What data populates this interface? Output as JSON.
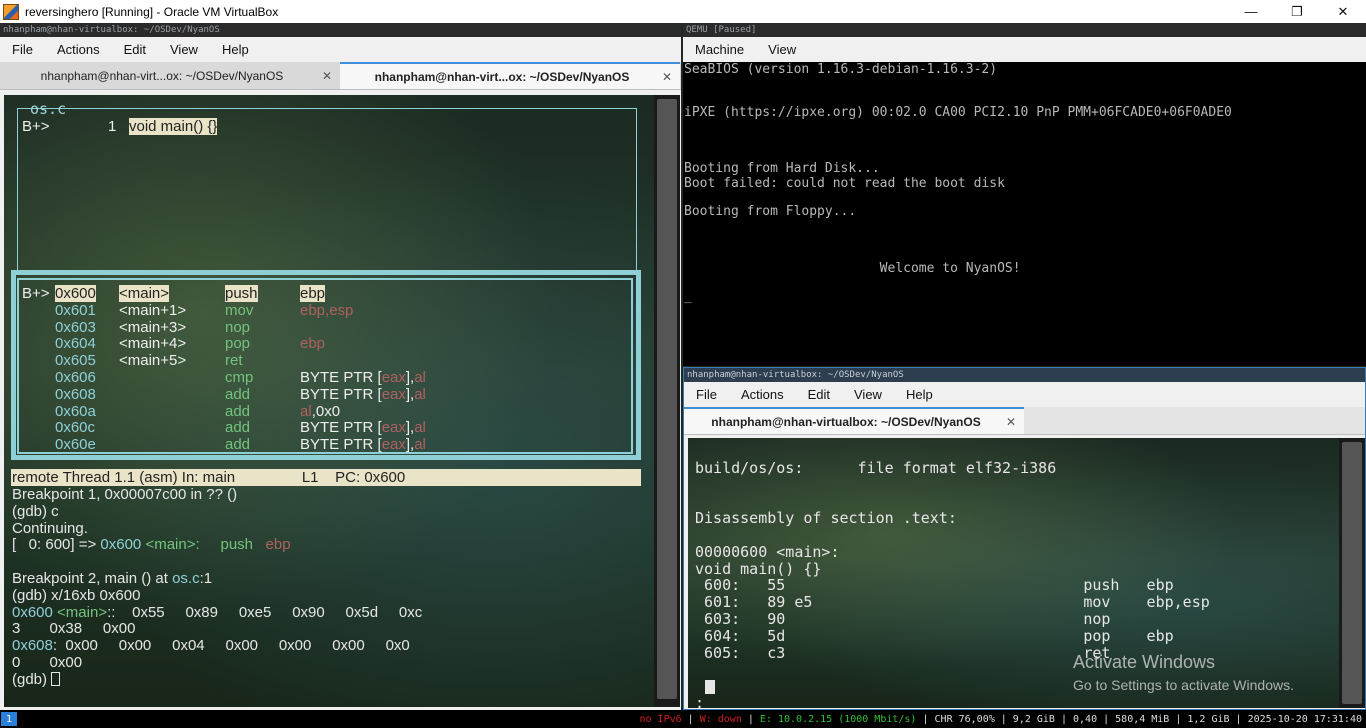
{
  "host": {
    "title": "reversinghero [Running] - Oracle VM VirtualBox",
    "minimize": "—",
    "maximize": "❐",
    "close": "✕"
  },
  "left_window": {
    "title": "nhanpham@nhan-virtualbox: ~/OSDev/NyanOS",
    "menu": [
      "File",
      "Actions",
      "Edit",
      "View",
      "Help"
    ],
    "tabs": [
      {
        "label": "nhanpham@nhan-virt...ox: ~/OSDev/NyanOS",
        "close": "✕"
      },
      {
        "label": "nhanpham@nhan-virt...ox: ~/OSDev/NyanOS",
        "close": "✕"
      }
    ],
    "source": {
      "file": "os.c",
      "marker": "B+>",
      "line_no": "1",
      "code": "void main() {}"
    },
    "asm": [
      {
        "mark": "B+>",
        "addr": "0x600",
        "sym": "<main>",
        "op": "push",
        "args": "ebp"
      },
      {
        "mark": "",
        "addr": "0x601",
        "sym": "<main+1>",
        "op": "mov",
        "args": "ebp,esp"
      },
      {
        "mark": "",
        "addr": "0x603",
        "sym": "<main+3>",
        "op": "nop",
        "args": ""
      },
      {
        "mark": "",
        "addr": "0x604",
        "sym": "<main+4>",
        "op": "pop",
        "args": "ebp"
      },
      {
        "mark": "",
        "addr": "0x605",
        "sym": "<main+5>",
        "op": "ret",
        "args": ""
      },
      {
        "mark": "",
        "addr": "0x606",
        "sym": "",
        "op": "cmp",
        "args": "BYTE PTR [eax],al"
      },
      {
        "mark": "",
        "addr": "0x608",
        "sym": "",
        "op": "add",
        "args": "BYTE PTR [eax],al"
      },
      {
        "mark": "",
        "addr": "0x60a",
        "sym": "",
        "op": "add",
        "args": "al,0x0"
      },
      {
        "mark": "",
        "addr": "0x60c",
        "sym": "",
        "op": "add",
        "args": "BYTE PTR [eax],al"
      },
      {
        "mark": "",
        "addr": "0x60e",
        "sym": "",
        "op": "add",
        "args": "BYTE PTR [eax],al"
      }
    ],
    "status": "remote Thread 1.1 (asm) In: main                L1    PC: 0x600",
    "console": [
      "Breakpoint 1, 0x00007c00 in ?? ()",
      "(gdb) c",
      "Continuing.",
      "[   0: 600] => 0x600 <main>:     push   ebp",
      "",
      "Breakpoint 2, main () at os.c:1",
      "(gdb) x/16xb 0x600",
      "0x600 <main>:    0x55     0x89     0xe5     0x90     0x5d     0xc",
      "3       0x38     0x00",
      "0x608:  0x00     0x00     0x04     0x00     0x00     0x00     0x0",
      "0       0x00",
      "(gdb) "
    ]
  },
  "qemu": {
    "title": "QEMU [Paused]",
    "menu": [
      "Machine",
      "View"
    ],
    "lines": [
      "SeaBIOS (version 1.16.3-debian-1.16.3-2)",
      "",
      "",
      "iPXE (https://ipxe.org) 00:02.0 CA00 PCI2.10 PnP PMM+06FCADE0+06F0ADE0",
      "",
      "",
      "",
      "Booting from Hard Disk...",
      "Boot failed: could not read the boot disk",
      "",
      "Booting from Floppy...",
      "",
      "",
      "",
      "                         Welcome to NyanOS!",
      "",
      "_"
    ]
  },
  "right_window": {
    "title": "nhanpham@nhan-virtualbox: ~/OSDev/NyanOS",
    "menu": [
      "File",
      "Actions",
      "Edit",
      "View",
      "Help"
    ],
    "tab": {
      "label": "nhanpham@nhan-virtualbox: ~/OSDev/NyanOS",
      "close": "✕"
    },
    "lines": [
      "",
      "build/os/os:      file format elf32-i386",
      "",
      "",
      "Disassembly of section .text:",
      "",
      "00000600 <main>:",
      "void main() {}",
      " 600:   55                                 push   ebp",
      " 601:   89 e5                              mov    ebp,esp",
      " 603:   90                                 nop",
      " 604:   5d                                 pop    ebp",
      " 605:   c3                                 ret",
      "",
      "",
      ":"
    ]
  },
  "watermark": {
    "title": "Activate Windows",
    "subtitle": "Go to Settings to activate Windows."
  },
  "taskbar": {
    "workspace": "1",
    "ipv6": "no IPv6",
    "wifi": "W: down",
    "eth": "E: 10.0.2.15 (1000 Mbit/s)",
    "rest": "CHR 76,00% | 9,2 GiB | 0,40 | 580,4 MiB | 1,2 GiB | 2025-10-20 17:31:40",
    "sep": " | "
  }
}
